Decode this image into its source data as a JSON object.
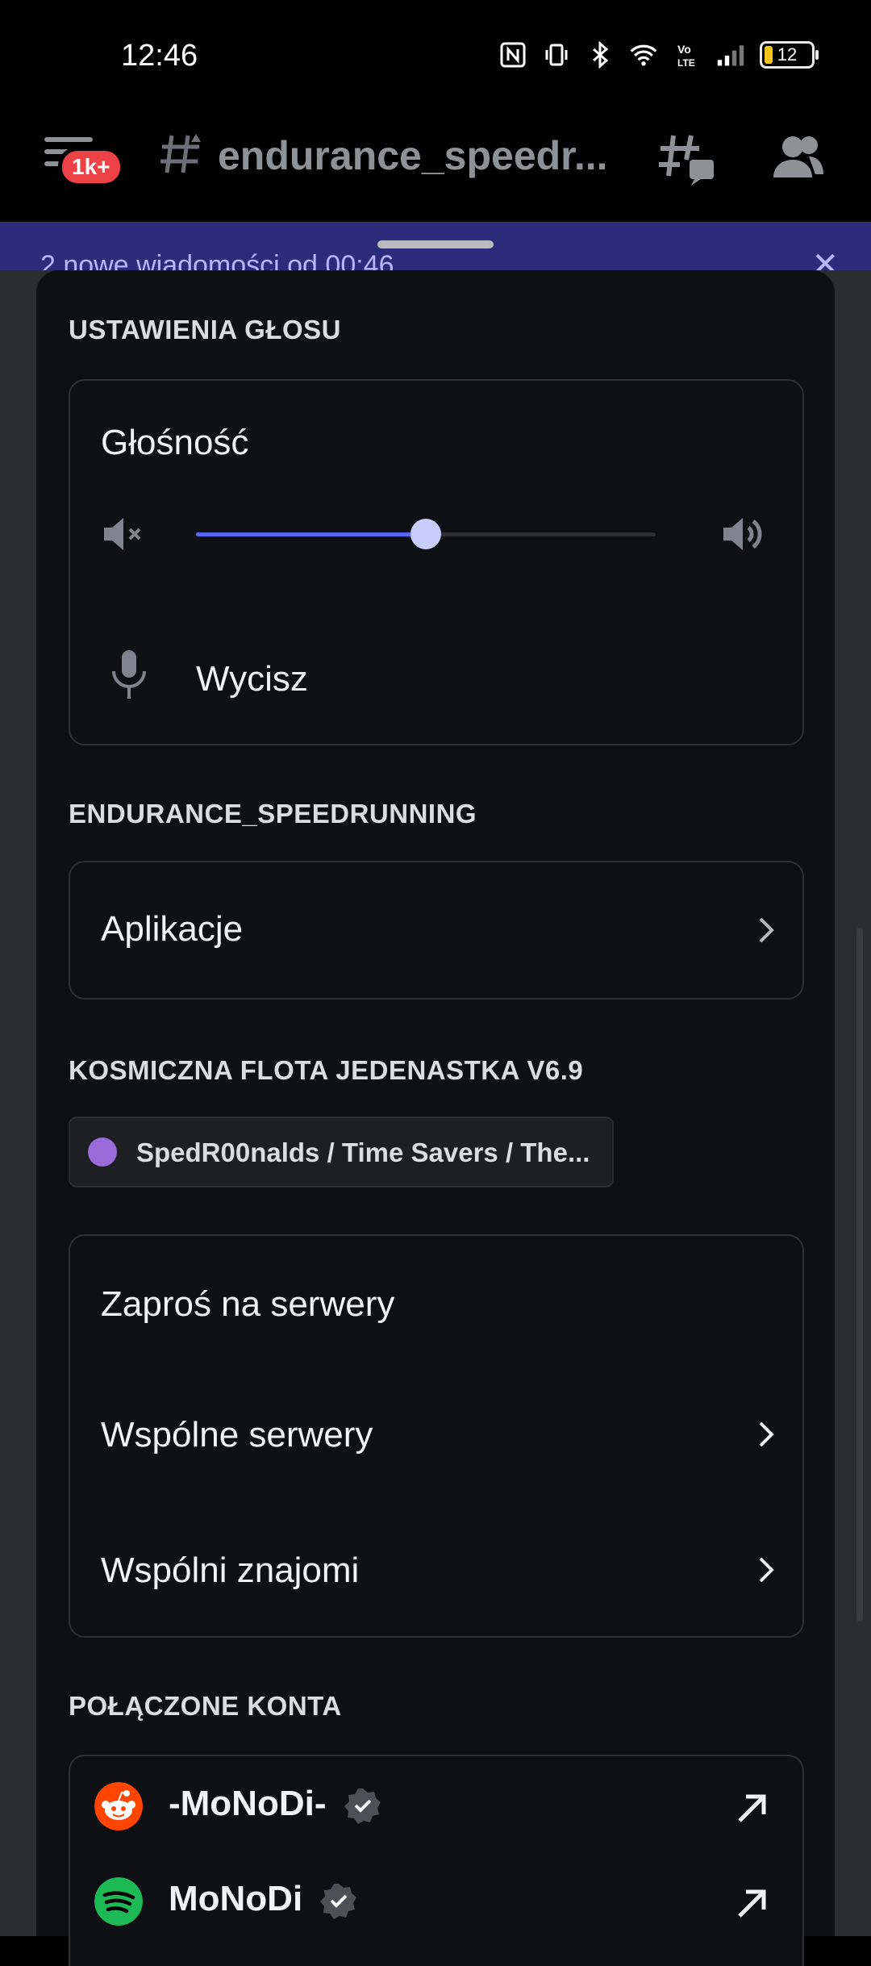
{
  "status_bar": {
    "time": "12:46",
    "battery": "12"
  },
  "header": {
    "badge": "1k+",
    "channel_name": "endurance_speedr..."
  },
  "banner": {
    "text": "2 nowe wiadomości od 00:46"
  },
  "voice_settings": {
    "section_title": "USTAWIENIA GŁOSU",
    "volume_label": "Głośność",
    "volume_level": 0.5,
    "mute_label": "Wycisz"
  },
  "server_section": {
    "title": "ENDURANCE_SPEEDRUNNING",
    "apps_label": "Aplikacje"
  },
  "profile_section": {
    "title": "KOSMICZNA FLOTA JEDENASTKA V6.9",
    "activity": "SpedR00nalds / Time Savers / The..."
  },
  "actions": {
    "invite": "Zaproś na serwery",
    "mutual_servers": "Wspólne serwery",
    "mutual_friends": "Wspólni znajomi"
  },
  "connections": {
    "title": "POŁĄCZONE KONTA",
    "accounts": [
      {
        "name": "-MoNoDi-",
        "service": "reddit-icon",
        "color": "#ff4500"
      },
      {
        "name": "MoNoDi",
        "service": "spotify-icon",
        "color": "#1db954"
      }
    ]
  },
  "colors": {
    "accent": "#5865f2",
    "background": "#0e1013"
  }
}
